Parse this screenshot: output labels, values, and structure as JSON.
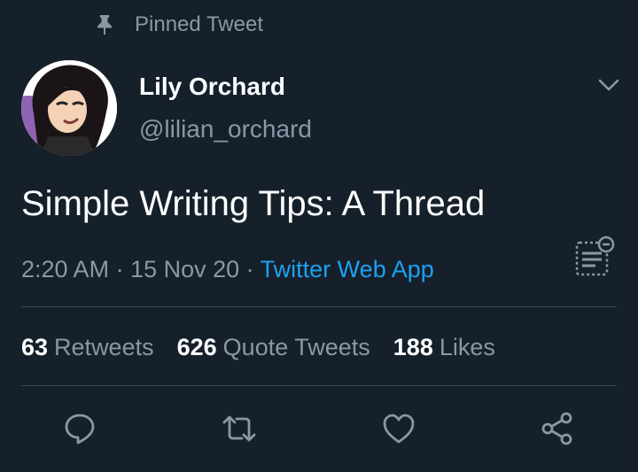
{
  "pinned": {
    "label": "Pinned Tweet",
    "icon": "pin-icon"
  },
  "user": {
    "display_name": "Lily Orchard",
    "handle": "@lilian_orchard",
    "avatar_icon": "avatar-image"
  },
  "tweet": {
    "text": "Simple Writing Tips: A Thread",
    "time": "2:20 AM",
    "sep1": " · ",
    "date": "15 Nov 20",
    "sep2": " · ",
    "source": "Twitter Web App"
  },
  "stats": {
    "retweets_count": "63",
    "retweets_label": "Retweets",
    "quotes_count": "626",
    "quotes_label": "Quote Tweets",
    "likes_count": "188",
    "likes_label": "Likes"
  },
  "actions": [
    "reply-icon",
    "retweet-icon",
    "like-icon",
    "share-icon"
  ],
  "colors": {
    "background": "#15202b",
    "muted": "#8899a6",
    "link": "#1da1f2",
    "divider": "#38444d"
  }
}
